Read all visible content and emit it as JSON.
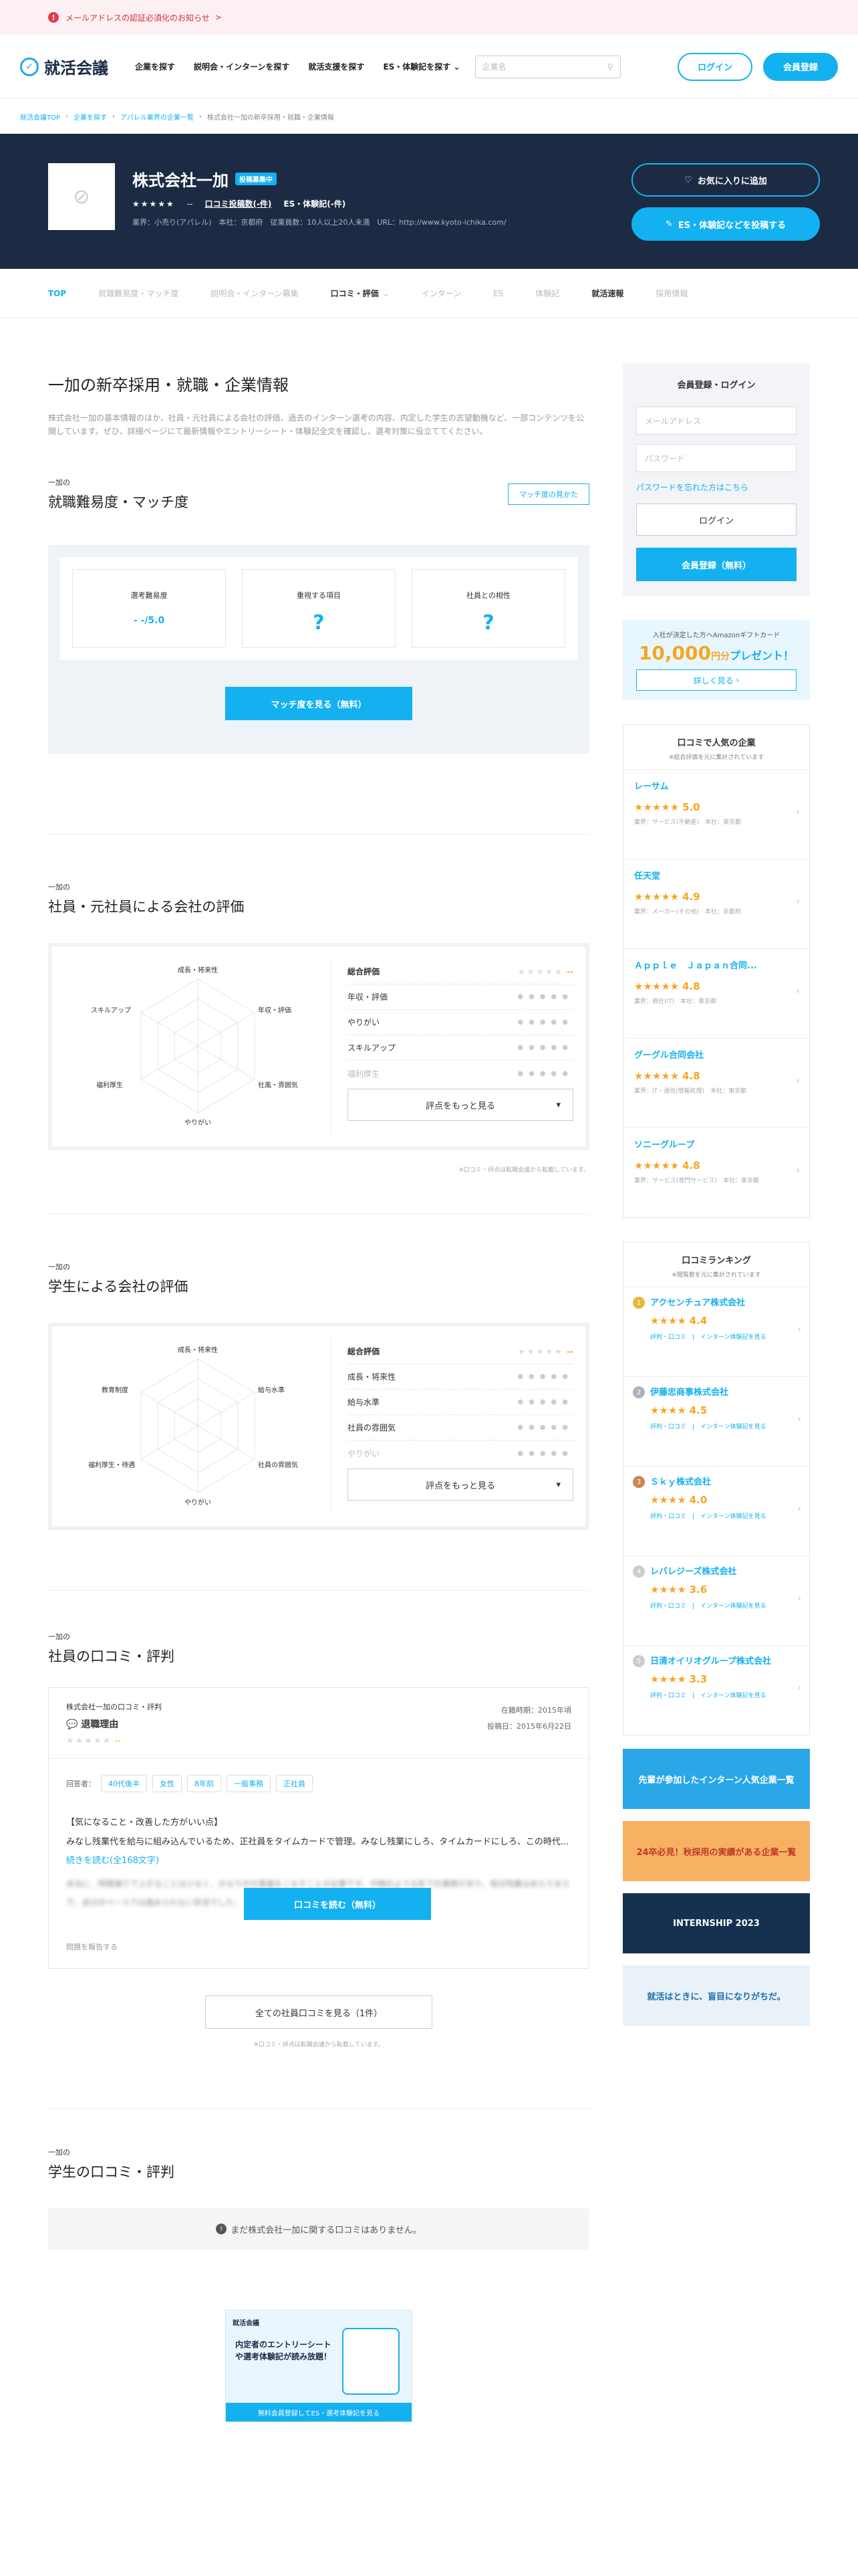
{
  "notice": {
    "text": "メールアドレスの認証必須化のお知らせ",
    "arrow": ">"
  },
  "header": {
    "logo": "就活会議",
    "nav": [
      "企業を探す",
      "説明会・インターンを探す",
      "就活支援を探す",
      "ES・体験記を探す"
    ],
    "search_placeholder": "企業名",
    "login": "ログイン",
    "register": "会員登録"
  },
  "breadcrumb": [
    "就活会議TOP",
    "企業を探す",
    "アパレル業界の企業一覧",
    "株式会社一加の新卒採用・就職・企業情報"
  ],
  "company": {
    "name": "株式会社一加",
    "tag": "投稿募集中",
    "stars": "★★★★★",
    "score": "--",
    "review_count": "口コミ投稿数(-件)",
    "es_count": "ES・体験記(-件)",
    "meta": "業界：小売り(アパレル)　本社：京都府　従業員数：10人以上20人未満　URL：http://www.kyoto-ichika.com/",
    "fav_button": "お気に入りに追加",
    "post_button": "ES・体験記などを投稿する"
  },
  "tabs": [
    {
      "label": "TOP",
      "state": "on"
    },
    {
      "label": "就職難易度・マッチ度",
      "state": "off"
    },
    {
      "label": "説明会・インターン募集",
      "state": "off"
    },
    {
      "label": "口コミ・評価",
      "state": "dk"
    },
    {
      "label": "インターン",
      "state": "off"
    },
    {
      "label": "ES",
      "state": "off"
    },
    {
      "label": "体験記",
      "state": "off"
    },
    {
      "label": "就活速報",
      "state": "dk"
    },
    {
      "label": "採用情報",
      "state": "off"
    }
  ],
  "main": {
    "title": "一加の新卒採用・就職・企業情報",
    "intro": "株式会社一加の基本情報のほか、社員・元社員による会社の評価、過去のインターン選考の内容、内定した学生の志望動機など、一部コンテンツを公開しています。ぜひ、詳細ページにて最新情報やエントリーシート・体験記全文を確認し、選考対策に役立ててください。",
    "difficulty": {
      "small": "一加の",
      "heading": "就職難易度・マッチ度",
      "howto": "マッチ度の見かた",
      "cards": [
        {
          "label": "選考難易度",
          "value": "- -/5.0"
        },
        {
          "label": "重視する項目",
          "value": "?"
        },
        {
          "label": "社員との相性",
          "value": "?"
        }
      ],
      "button": "マッチ度を見る（無料）"
    },
    "employee_eval": {
      "small": "一加の",
      "heading": "社員・元社員による会社の評価",
      "radar": [
        "成長・将来性",
        "年収・評価",
        "社風・雰囲気",
        "やりがい",
        "福利厚生",
        "スキルアップ"
      ],
      "rows": [
        {
          "label": "総合評価",
          "val": "--"
        },
        {
          "label": "年収・評価",
          "val": "--"
        },
        {
          "label": "やりがい",
          "val": "--"
        },
        {
          "label": "スキルアップ",
          "val": "--"
        },
        {
          "label": "福利厚生",
          "val": "--"
        }
      ],
      "more": "評点をもっと見る",
      "note": "※口コミ・評点は転職会議から転載しています。"
    },
    "student_eval": {
      "small": "一加の",
      "heading": "学生による会社の評価",
      "radar": [
        "成長・将来性",
        "給与水準",
        "社員の雰囲気",
        "やりがい",
        "福利厚生・待遇",
        "教育制度"
      ],
      "rows": [
        {
          "label": "総合評価",
          "val": "--"
        },
        {
          "label": "成長・将来性",
          "val": "--"
        },
        {
          "label": "給与水準",
          "val": "--"
        },
        {
          "label": "社員の雰囲気",
          "val": "--"
        },
        {
          "label": "やりがい",
          "val": "--"
        }
      ],
      "more": "評点をもっと見る"
    },
    "reviews": {
      "small": "一加の",
      "heading": "社員の口コミ・評判",
      "company": "株式会社一加の口コミ・評判",
      "category": "退職理由",
      "stars": "★★★★★",
      "score": "--",
      "period": "在籍時期：2015年頃",
      "posted": "投稿日：2015年6月22日",
      "answerer": "回答者：",
      "tags": [
        "40代後半",
        "女性",
        "8年前",
        "一般事務",
        "正社員"
      ],
      "q": "【気になること・改善した方がいい点】",
      "body": "みなし残業代を給与に組み込んでいるため、正社員をタイムカードで管理。みなし残業にしろ、タイムカードにしろ、この時代...",
      "link": "続きを読む(全168文字)",
      "blurred": "本当に、時間通りで上がることは少なく、かなりの仕事量をこなすことが必要です。中略のような形での業務があり、毎日残業はあたりまえで、自分のペースでは進められない状況でした。",
      "read": "口コミを読む（無料）",
      "report": "問題を報告する",
      "all": "全ての社員口コミを見る（1件）",
      "note": "※口コミ・評点は転職会議から転載しています。"
    },
    "student_reviews": {
      "small": "一加の",
      "heading": "学生の口コミ・評判",
      "empty": "まだ株式会社一加に関する口コミはありません。"
    },
    "ad": {
      "title": "就活会議",
      "text": "内定者のエントリーシートや選考体験記が読み放題！",
      "cta": "無料会員登録してES・選考体験記を見る"
    }
  },
  "side": {
    "login": {
      "title": "会員登録・ログイン",
      "email": "メールアドレス",
      "pass": "パスワード",
      "forgot": "パスワードを忘れた方はこちら",
      "login": "ログイン",
      "register": "会員登録（無料）"
    },
    "promo": {
      "line": "入社が決定した方へAmazonギフトカード",
      "amount": "10,000",
      "unit": "円分",
      "suffix": "プレゼント！",
      "link": "詳しく見る"
    },
    "popular": {
      "title": "口コミで人気の企業",
      "sub": "※総合評価を元に集計されています",
      "items": [
        {
          "name": "レーサム",
          "score": "5.0",
          "sub": "業界：サービス(不動産)　本社：東京都"
        },
        {
          "name": "任天堂",
          "score": "4.9",
          "sub": "業界：メーカー(その他)　本社：京都府"
        },
        {
          "name": "Ａｐｐｌｅ　Ｊａｐａｎ合同...",
          "score": "4.8",
          "sub": "業界：商社(IT)　本社：東京都"
        },
        {
          "name": "グーグル合同会社",
          "score": "4.8",
          "sub": "業界：IT・通信(情報処理)　本社：東京都"
        },
        {
          "name": "ソニーグループ",
          "score": "4.8",
          "sub": "業界：サービス(専門サービス)　本社：東京都"
        }
      ]
    },
    "ranking": {
      "title": "口コミランキング",
      "sub": "※閲覧数を元に集計されています",
      "items": [
        {
          "n": "1",
          "name": "アクセンチュア株式会社",
          "score": "4.4",
          "color": "#e2b93b"
        },
        {
          "n": "2",
          "name": "伊藤忠商事株式会社",
          "score": "4.5",
          "color": "#a8b3bf"
        },
        {
          "n": "3",
          "name": "Ｓｋｙ株式会社",
          "score": "4.0",
          "color": "#c98752"
        },
        {
          "n": "4",
          "name": "レバレジーズ株式会社",
          "score": "3.6",
          "color": "#cccccc"
        },
        {
          "n": "5",
          "name": "日清オイリオグループ株式会社",
          "score": "3.3",
          "color": "#cccccc"
        }
      ],
      "links": "評判・口コミ　|　インターン体験記を見る"
    },
    "banners": [
      {
        "text": "先輩が参加したインターン人気企業一覧",
        "bg": "#2aa7e6",
        "fg": "#ffffff"
      },
      {
        "text": "24卒必見！秋採用の実績がある企業一覧",
        "bg": "#f7b163",
        "fg": "#c0392b"
      },
      {
        "text": "INTERNSHIP 2023",
        "bg": "#16314f",
        "fg": "#ffffff"
      },
      {
        "text": "就活はときに、盲目になりがちだ。",
        "bg": "#e9f2f8",
        "fg": "#1a6fb0"
      }
    ]
  }
}
